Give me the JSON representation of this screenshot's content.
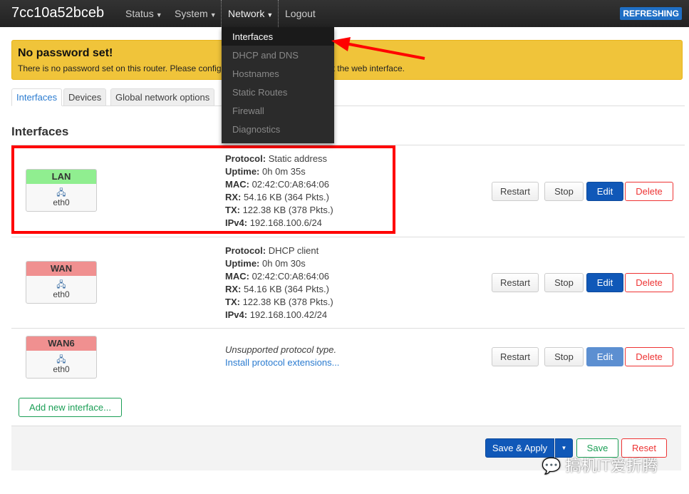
{
  "header": {
    "brand": "7cc10a52bceb",
    "menus": [
      "Status",
      "System",
      "Network",
      "Logout"
    ],
    "refresh": "REFRESHING"
  },
  "dropdown": [
    "Interfaces",
    "DHCP and DNS",
    "Hostnames",
    "Static Routes",
    "Firewall",
    "Diagnostics"
  ],
  "alert": {
    "title": "No password set!",
    "text": "There is no password set on this router. Please configure a root password to protect the web interface."
  },
  "tabs": [
    "Interfaces",
    "Devices",
    "Global network options"
  ],
  "heading": "Interfaces",
  "labels": {
    "protocol": "Protocol:",
    "uptime": "Uptime:",
    "mac": "MAC:",
    "rx": "RX:",
    "tx": "TX:",
    "ipv4": "IPv4:"
  },
  "interfaces": [
    {
      "name": "LAN",
      "color": "#90ee90",
      "device": "eth0",
      "protocol": "Static address",
      "uptime": "0h 0m 35s",
      "mac": "02:42:C0:A8:64:06",
      "rx": "54.16 KB (364 Pkts.)",
      "tx": "122.38 KB (378 Pkts.)",
      "ipv4": "192.168.100.6/24"
    },
    {
      "name": "WAN",
      "color": "#f09090",
      "device": "eth0",
      "protocol": "DHCP client",
      "uptime": "0h 0m 30s",
      "mac": "02:42:C0:A8:64:06",
      "rx": "54.16 KB (364 Pkts.)",
      "tx": "122.38 KB (378 Pkts.)",
      "ipv4": "192.168.100.42/24"
    },
    {
      "name": "WAN6",
      "color": "#f09090",
      "device": "eth0",
      "unsupported": "Unsupported protocol type.",
      "install": "Install protocol extensions..."
    }
  ],
  "buttons": {
    "restart": "Restart",
    "stop": "Stop",
    "edit": "Edit",
    "delete": "Delete",
    "add": "Add new interface...",
    "save_apply": "Save & Apply",
    "save": "Save",
    "reset": "Reset"
  },
  "watermark": "搞机IT爱折腾"
}
